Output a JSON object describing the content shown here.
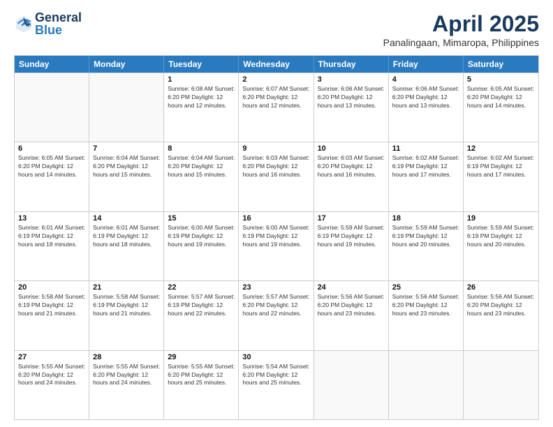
{
  "header": {
    "logo_general": "General",
    "logo_blue": "Blue",
    "month_year": "April 2025",
    "location": "Panalingaan, Mimaropa, Philippines"
  },
  "days_of_week": [
    "Sunday",
    "Monday",
    "Tuesday",
    "Wednesday",
    "Thursday",
    "Friday",
    "Saturday"
  ],
  "weeks": [
    [
      {
        "day": "",
        "info": ""
      },
      {
        "day": "",
        "info": ""
      },
      {
        "day": "1",
        "info": "Sunrise: 6:08 AM\nSunset: 6:20 PM\nDaylight: 12 hours and 12 minutes."
      },
      {
        "day": "2",
        "info": "Sunrise: 6:07 AM\nSunset: 6:20 PM\nDaylight: 12 hours and 12 minutes."
      },
      {
        "day": "3",
        "info": "Sunrise: 6:06 AM\nSunset: 6:20 PM\nDaylight: 12 hours and 13 minutes."
      },
      {
        "day": "4",
        "info": "Sunrise: 6:06 AM\nSunset: 6:20 PM\nDaylight: 12 hours and 13 minutes."
      },
      {
        "day": "5",
        "info": "Sunrise: 6:05 AM\nSunset: 6:20 PM\nDaylight: 12 hours and 14 minutes."
      }
    ],
    [
      {
        "day": "6",
        "info": "Sunrise: 6:05 AM\nSunset: 6:20 PM\nDaylight: 12 hours and 14 minutes."
      },
      {
        "day": "7",
        "info": "Sunrise: 6:04 AM\nSunset: 6:20 PM\nDaylight: 12 hours and 15 minutes."
      },
      {
        "day": "8",
        "info": "Sunrise: 6:04 AM\nSunset: 6:20 PM\nDaylight: 12 hours and 15 minutes."
      },
      {
        "day": "9",
        "info": "Sunrise: 6:03 AM\nSunset: 6:20 PM\nDaylight: 12 hours and 16 minutes."
      },
      {
        "day": "10",
        "info": "Sunrise: 6:03 AM\nSunset: 6:20 PM\nDaylight: 12 hours and 16 minutes."
      },
      {
        "day": "11",
        "info": "Sunrise: 6:02 AM\nSunset: 6:19 PM\nDaylight: 12 hours and 17 minutes."
      },
      {
        "day": "12",
        "info": "Sunrise: 6:02 AM\nSunset: 6:19 PM\nDaylight: 12 hours and 17 minutes."
      }
    ],
    [
      {
        "day": "13",
        "info": "Sunrise: 6:01 AM\nSunset: 6:19 PM\nDaylight: 12 hours and 18 minutes."
      },
      {
        "day": "14",
        "info": "Sunrise: 6:01 AM\nSunset: 6:19 PM\nDaylight: 12 hours and 18 minutes."
      },
      {
        "day": "15",
        "info": "Sunrise: 6:00 AM\nSunset: 6:19 PM\nDaylight: 12 hours and 19 minutes."
      },
      {
        "day": "16",
        "info": "Sunrise: 6:00 AM\nSunset: 6:19 PM\nDaylight: 12 hours and 19 minutes."
      },
      {
        "day": "17",
        "info": "Sunrise: 5:59 AM\nSunset: 6:19 PM\nDaylight: 12 hours and 19 minutes."
      },
      {
        "day": "18",
        "info": "Sunrise: 5:59 AM\nSunset: 6:19 PM\nDaylight: 12 hours and 20 minutes."
      },
      {
        "day": "19",
        "info": "Sunrise: 5:59 AM\nSunset: 6:19 PM\nDaylight: 12 hours and 20 minutes."
      }
    ],
    [
      {
        "day": "20",
        "info": "Sunrise: 5:58 AM\nSunset: 6:19 PM\nDaylight: 12 hours and 21 minutes."
      },
      {
        "day": "21",
        "info": "Sunrise: 5:58 AM\nSunset: 6:19 PM\nDaylight: 12 hours and 21 minutes."
      },
      {
        "day": "22",
        "info": "Sunrise: 5:57 AM\nSunset: 6:19 PM\nDaylight: 12 hours and 22 minutes."
      },
      {
        "day": "23",
        "info": "Sunrise: 5:57 AM\nSunset: 6:20 PM\nDaylight: 12 hours and 22 minutes."
      },
      {
        "day": "24",
        "info": "Sunrise: 5:56 AM\nSunset: 6:20 PM\nDaylight: 12 hours and 23 minutes."
      },
      {
        "day": "25",
        "info": "Sunrise: 5:56 AM\nSunset: 6:20 PM\nDaylight: 12 hours and 23 minutes."
      },
      {
        "day": "26",
        "info": "Sunrise: 5:56 AM\nSunset: 6:20 PM\nDaylight: 12 hours and 23 minutes."
      }
    ],
    [
      {
        "day": "27",
        "info": "Sunrise: 5:55 AM\nSunset: 6:20 PM\nDaylight: 12 hours and 24 minutes."
      },
      {
        "day": "28",
        "info": "Sunrise: 5:55 AM\nSunset: 6:20 PM\nDaylight: 12 hours and 24 minutes."
      },
      {
        "day": "29",
        "info": "Sunrise: 5:55 AM\nSunset: 6:20 PM\nDaylight: 12 hours and 25 minutes."
      },
      {
        "day": "30",
        "info": "Sunrise: 5:54 AM\nSunset: 6:20 PM\nDaylight: 12 hours and 25 minutes."
      },
      {
        "day": "",
        "info": ""
      },
      {
        "day": "",
        "info": ""
      },
      {
        "day": "",
        "info": ""
      }
    ]
  ]
}
